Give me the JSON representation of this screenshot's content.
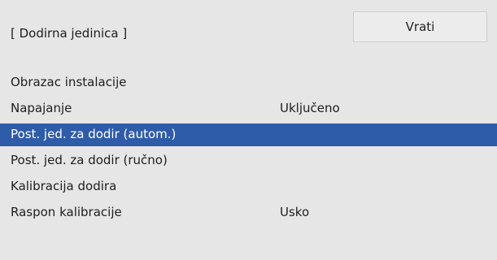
{
  "header": {
    "title": "[ Dodirna jedinica ]",
    "back_label": "Vrati"
  },
  "menu": {
    "selected_index": 2,
    "items": [
      {
        "label": "Obrazac instalacije",
        "value": ""
      },
      {
        "label": "Napajanje",
        "value": "Uključeno"
      },
      {
        "label": "Post. jed. za dodir (autom.)",
        "value": ""
      },
      {
        "label": "Post. jed. za dodir (ručno)",
        "value": ""
      },
      {
        "label": "Kalibracija dodira",
        "value": ""
      },
      {
        "label": "Raspon kalibracije",
        "value": "Usko"
      }
    ]
  },
  "colors": {
    "background": "#e6e6e6",
    "selected": "#2f5ca8"
  }
}
